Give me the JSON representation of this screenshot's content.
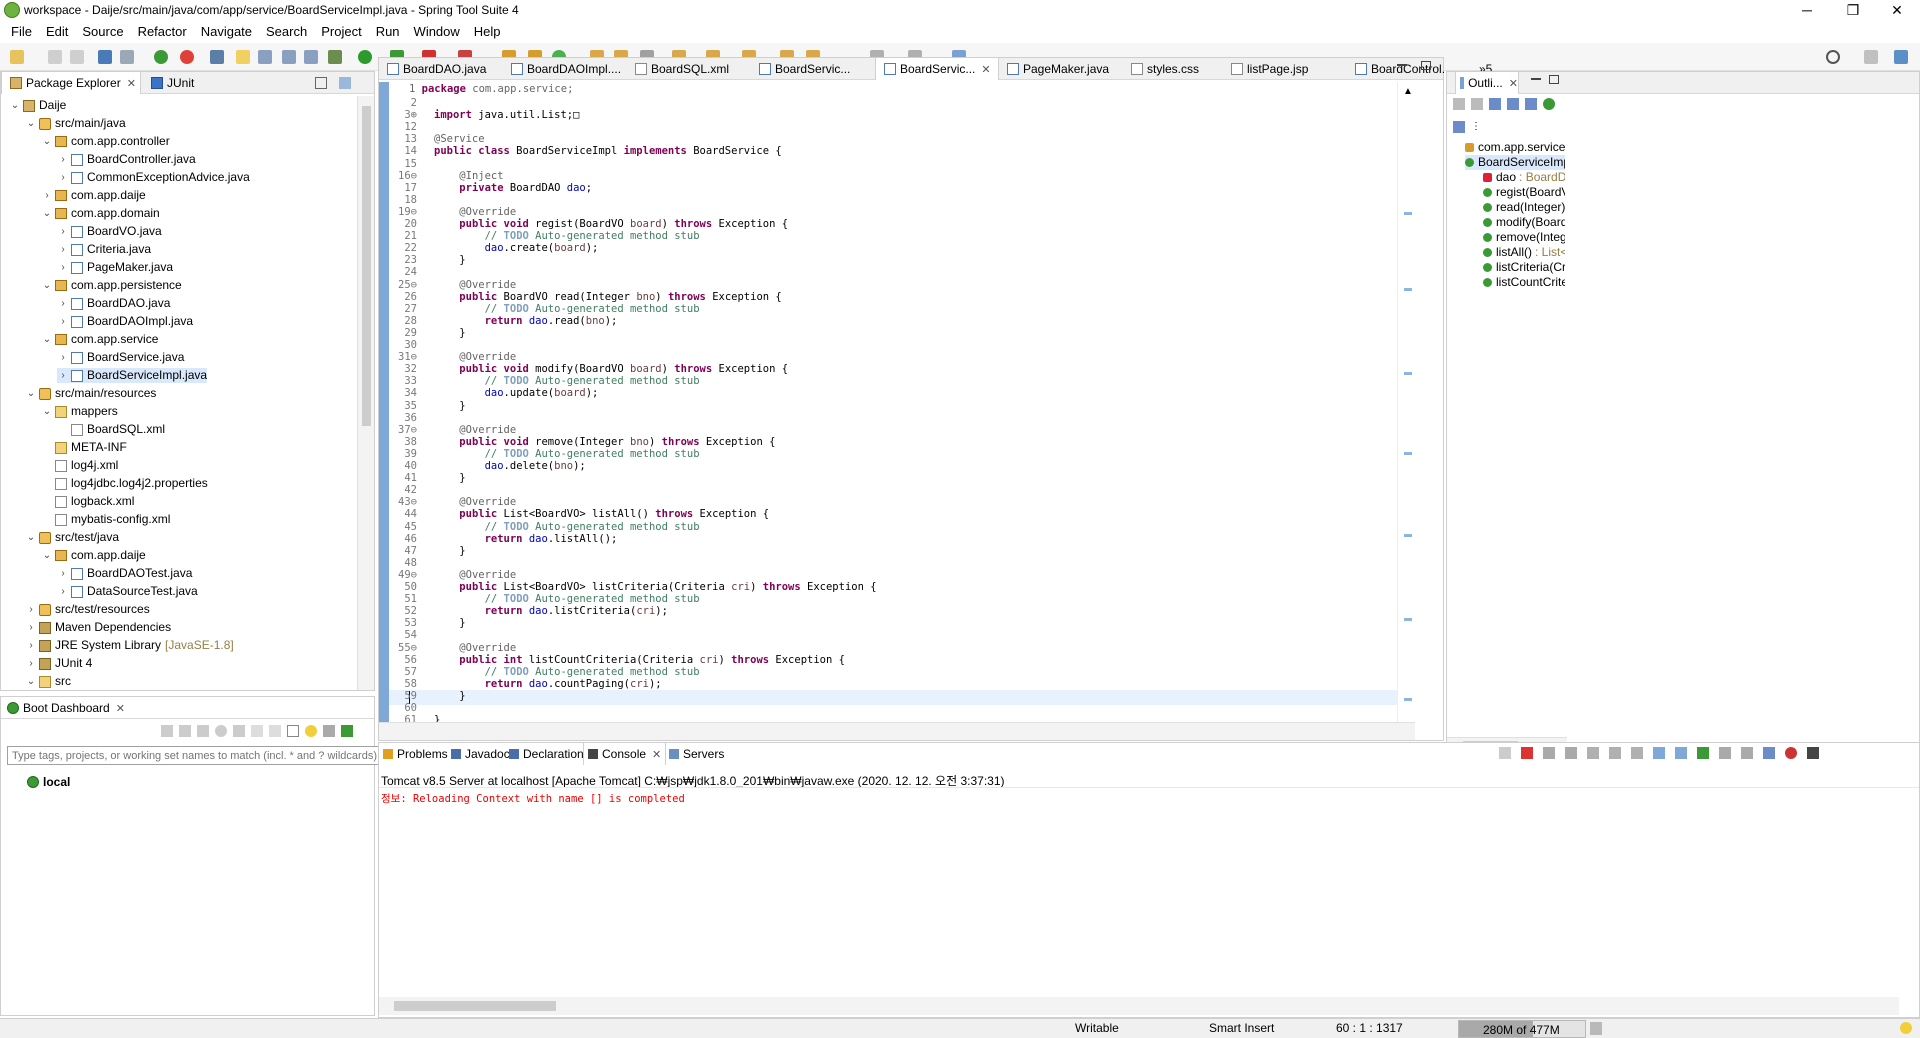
{
  "window": {
    "title": "workspace - Daije/src/main/java/com/app/service/BoardServiceImpl.java - Spring Tool Suite 4",
    "minimize": "─",
    "maximize": "❐",
    "close": "✕"
  },
  "menu": [
    "File",
    "Edit",
    "Source",
    "Refactor",
    "Navigate",
    "Search",
    "Project",
    "Run",
    "Window",
    "Help"
  ],
  "package_explorer": {
    "tabs": [
      "Package Explorer",
      "JUnit"
    ],
    "tree": [
      {
        "depth": 0,
        "tw": "v",
        "icon": "ico-pkgexp",
        "label": "Daije"
      },
      {
        "depth": 1,
        "tw": "v",
        "icon": "ico-src",
        "label": "src/main/java"
      },
      {
        "depth": 2,
        "tw": "v",
        "icon": "ico-pkg",
        "label": "com.app.controller"
      },
      {
        "depth": 3,
        "tw": ">",
        "icon": "ico-java",
        "label": "BoardController.java"
      },
      {
        "depth": 3,
        "tw": ">",
        "icon": "ico-java",
        "label": "CommonExceptionAdvice.java"
      },
      {
        "depth": 2,
        "tw": ">",
        "icon": "ico-pkg",
        "label": "com.app.daije"
      },
      {
        "depth": 2,
        "tw": "v",
        "icon": "ico-pkg",
        "label": "com.app.domain"
      },
      {
        "depth": 3,
        "tw": ">",
        "icon": "ico-java",
        "label": "BoardVO.java"
      },
      {
        "depth": 3,
        "tw": ">",
        "icon": "ico-java",
        "label": "Criteria.java"
      },
      {
        "depth": 3,
        "tw": ">",
        "icon": "ico-java",
        "label": "PageMaker.java"
      },
      {
        "depth": 2,
        "tw": "v",
        "icon": "ico-pkg",
        "label": "com.app.persistence"
      },
      {
        "depth": 3,
        "tw": ">",
        "icon": "ico-java",
        "label": "BoardDAO.java"
      },
      {
        "depth": 3,
        "tw": ">",
        "icon": "ico-java",
        "label": "BoardDAOImpl.java"
      },
      {
        "depth": 2,
        "tw": "v",
        "icon": "ico-pkg",
        "label": "com.app.service"
      },
      {
        "depth": 3,
        "tw": ">",
        "icon": "ico-java",
        "label": "BoardService.java"
      },
      {
        "depth": 3,
        "tw": ">",
        "icon": "ico-java",
        "label": "BoardServiceImpl.java",
        "selected": true
      },
      {
        "depth": 1,
        "tw": "v",
        "icon": "ico-src",
        "label": "src/main/resources"
      },
      {
        "depth": 2,
        "tw": "v",
        "icon": "ico-folder",
        "label": "mappers"
      },
      {
        "depth": 3,
        "tw": "",
        "icon": "ico-xml",
        "label": "BoardSQL.xml"
      },
      {
        "depth": 2,
        "tw": "",
        "icon": "ico-folder",
        "label": "META-INF"
      },
      {
        "depth": 2,
        "tw": "",
        "icon": "ico-xml",
        "label": "log4j.xml"
      },
      {
        "depth": 2,
        "tw": "",
        "icon": "ico-xml",
        "label": "log4jdbc.log4j2.properties"
      },
      {
        "depth": 2,
        "tw": "",
        "icon": "ico-xml",
        "label": "logback.xml"
      },
      {
        "depth": 2,
        "tw": "",
        "icon": "ico-xml",
        "label": "mybatis-config.xml"
      },
      {
        "depth": 1,
        "tw": "v",
        "icon": "ico-src",
        "label": "src/test/java"
      },
      {
        "depth": 2,
        "tw": "v",
        "icon": "ico-pkg",
        "label": "com.app.daije"
      },
      {
        "depth": 3,
        "tw": ">",
        "icon": "ico-java",
        "label": "BoardDAOTest.java"
      },
      {
        "depth": 3,
        "tw": ">",
        "icon": "ico-java",
        "label": "DataSourceTest.java"
      },
      {
        "depth": 1,
        "tw": ">",
        "icon": "ico-src",
        "label": "src/test/resources"
      },
      {
        "depth": 1,
        "tw": ">",
        "icon": "ico-lib",
        "label": "Maven Dependencies"
      },
      {
        "depth": 1,
        "tw": ">",
        "icon": "ico-lib",
        "label": "JRE System Library",
        "suffix": "[JavaSE-1.8]"
      },
      {
        "depth": 1,
        "tw": ">",
        "icon": "ico-lib",
        "label": "JUnit 4"
      },
      {
        "depth": 1,
        "tw": "v",
        "icon": "ico-folder",
        "label": "src"
      }
    ]
  },
  "boot_dashboard": {
    "tab": "Boot Dashboard",
    "filter_placeholder": "Type tags, projects, or working set names to match (incl. * and ? wildcards)",
    "item": "local"
  },
  "editor_tabs": [
    "BoardDAO.java",
    "BoardDAOImpl....",
    "BoardSQL.xml",
    "BoardServic...",
    "BoardServic...",
    "PageMaker.java",
    "styles.css",
    "listPage.jsp",
    "BoardControl...",
    "»5"
  ],
  "code_lines": [
    {
      "n": "2",
      "html": ""
    },
    {
      "n": "3⊕",
      "html": "<span class='kw'>import</span> java.util.List;□"
    },
    {
      "n": "12",
      "html": ""
    },
    {
      "n": "13",
      "html": "<span class='an'>@Service</span>"
    },
    {
      "n": "14",
      "html": "<span class='kw'>public class</span> BoardServiceImpl <span class='kw'>implements</span> BoardService {"
    },
    {
      "n": "15",
      "html": ""
    },
    {
      "n": "16⊖",
      "html": "    <span class='an'>@Inject</span>"
    },
    {
      "n": "17",
      "html": "    <span class='kw'>private</span> BoardDAO <span class='fd'>dao</span>;"
    },
    {
      "n": "18",
      "html": ""
    },
    {
      "n": "19⊖",
      "html": "    <span class='an'>@Override</span>"
    },
    {
      "n": "20",
      "html": "    <span class='kw'>public void</span> regist(BoardVO <span class='pm'>board</span>) <span class='kw'>throws</span> Exception {"
    },
    {
      "n": "21",
      "html": "        <span class='cm'>// <span class='todo'>TODO</span> Auto-generated method stub</span>"
    },
    {
      "n": "22",
      "html": "        <span class='fd'>dao</span>.create(<span class='pm'>board</span>);"
    },
    {
      "n": "23",
      "html": "    }"
    },
    {
      "n": "24",
      "html": ""
    },
    {
      "n": "25⊖",
      "html": "    <span class='an'>@Override</span>"
    },
    {
      "n": "26",
      "html": "    <span class='kw'>public</span> BoardVO read(Integer <span class='pm'>bno</span>) <span class='kw'>throws</span> Exception {"
    },
    {
      "n": "27",
      "html": "        <span class='cm'>// <span class='todo'>TODO</span> Auto-generated method stub</span>"
    },
    {
      "n": "28",
      "html": "        <span class='kw'>return</span> <span class='fd'>dao</span>.read(<span class='pm'>bno</span>);"
    },
    {
      "n": "29",
      "html": "    }"
    },
    {
      "n": "30",
      "html": ""
    },
    {
      "n": "31⊖",
      "html": "    <span class='an'>@Override</span>"
    },
    {
      "n": "32",
      "html": "    <span class='kw'>public void</span> modify(BoardVO <span class='pm'>board</span>) <span class='kw'>throws</span> Exception {"
    },
    {
      "n": "33",
      "html": "        <span class='cm'>// <span class='todo'>TODO</span> Auto-generated method stub</span>"
    },
    {
      "n": "34",
      "html": "        <span class='fd'>dao</span>.update(<span class='pm'>board</span>);"
    },
    {
      "n": "35",
      "html": "    }"
    },
    {
      "n": "36",
      "html": ""
    },
    {
      "n": "37⊖",
      "html": "    <span class='an'>@Override</span>"
    },
    {
      "n": "38",
      "html": "    <span class='kw'>public void</span> remove(Integer <span class='pm'>bno</span>) <span class='kw'>throws</span> Exception {"
    },
    {
      "n": "39",
      "html": "        <span class='cm'>// <span class='todo'>TODO</span> Auto-generated method stub</span>"
    },
    {
      "n": "40",
      "html": "        <span class='fd'>dao</span>.delete(<span class='pm'>bno</span>);"
    },
    {
      "n": "41",
      "html": "    }"
    },
    {
      "n": "42",
      "html": ""
    },
    {
      "n": "43⊖",
      "html": "    <span class='an'>@Override</span>"
    },
    {
      "n": "44",
      "html": "    <span class='kw'>public</span> List&lt;BoardVO&gt; listAll() <span class='kw'>throws</span> Exception {"
    },
    {
      "n": "45",
      "html": "        <span class='cm'>// <span class='todo'>TODO</span> Auto-generated method stub</span>"
    },
    {
      "n": "46",
      "html": "        <span class='kw'>return</span> <span class='fd'>dao</span>.listAll();"
    },
    {
      "n": "47",
      "html": "    }"
    },
    {
      "n": "48",
      "html": ""
    },
    {
      "n": "49⊖",
      "html": "    <span class='an'>@Override</span>"
    },
    {
      "n": "50",
      "html": "    <span class='kw'>public</span> List&lt;BoardVO&gt; listCriteria(Criteria <span class='pm'>cri</span>) <span class='kw'>throws</span> Exception {"
    },
    {
      "n": "51",
      "html": "        <span class='cm'>// <span class='todo'>TODO</span> Auto-generated method stub</span>"
    },
    {
      "n": "52",
      "html": "        <span class='kw'>return</span> <span class='fd'>dao</span>.listCriteria(<span class='pm'>cri</span>);"
    },
    {
      "n": "53",
      "html": "    }"
    },
    {
      "n": "54",
      "html": ""
    },
    {
      "n": "55⊖",
      "html": "    <span class='an'>@Override</span>"
    },
    {
      "n": "56",
      "html": "    <span class='kw'>public int</span> listCountCriteria(Criteria <span class='pm'>cri</span>) <span class='kw'>throws</span> Exception {"
    },
    {
      "n": "57",
      "html": "        <span class='cm'>// <span class='todo'>TODO</span> Auto-generated method stub</span>"
    },
    {
      "n": "58",
      "html": "        <span class='kw'>return</span> <span class='fd'>dao</span>.countPaging(<span class='pm'>cri</span>);"
    },
    {
      "n": "59",
      "html": "    }"
    },
    {
      "n": "60",
      "html": ""
    },
    {
      "n": "61",
      "html": "}"
    },
    {
      "n": "62",
      "html": ""
    }
  ],
  "outline": {
    "tab": "Outli...",
    "items": [
      {
        "indent": 0,
        "icon": "pkg",
        "label": "com.app.service"
      },
      {
        "indent": 0,
        "icon": "class",
        "label": "BoardServiceImp"
      },
      {
        "indent": 1,
        "icon": "field",
        "label": "dao",
        "suffix": ": BoardD"
      },
      {
        "indent": 1,
        "icon": "method",
        "label": "regist(BoardVO"
      },
      {
        "indent": 1,
        "icon": "method",
        "label": "read(Integer) :"
      },
      {
        "indent": 1,
        "icon": "method",
        "label": "modify(Board"
      },
      {
        "indent": 1,
        "icon": "method",
        "label": "remove(Intege"
      },
      {
        "indent": 1,
        "icon": "method",
        "label": "listAll()",
        "suffix": ": List<"
      },
      {
        "indent": 1,
        "icon": "method",
        "label": "listCriteria(Crit"
      },
      {
        "indent": 1,
        "icon": "method",
        "label": "listCountCriter"
      }
    ]
  },
  "console": {
    "tabs": [
      "Problems",
      "Javadoc",
      "Declaration",
      "Console",
      "Servers"
    ],
    "server_line": "Tomcat v8.5 Server at localhost [Apache Tomcat] C:₩jsp₩jdk1.8.0_201₩bin₩javaw.exe  (2020. 12. 12. 오전 3:37:31)",
    "output": "정보: Reloading Context with name [] is completed"
  },
  "status": {
    "writable": "Writable",
    "insert_mode": "Smart Insert",
    "position": "60 : 1 : 1317",
    "memory": "280M of 477M"
  }
}
